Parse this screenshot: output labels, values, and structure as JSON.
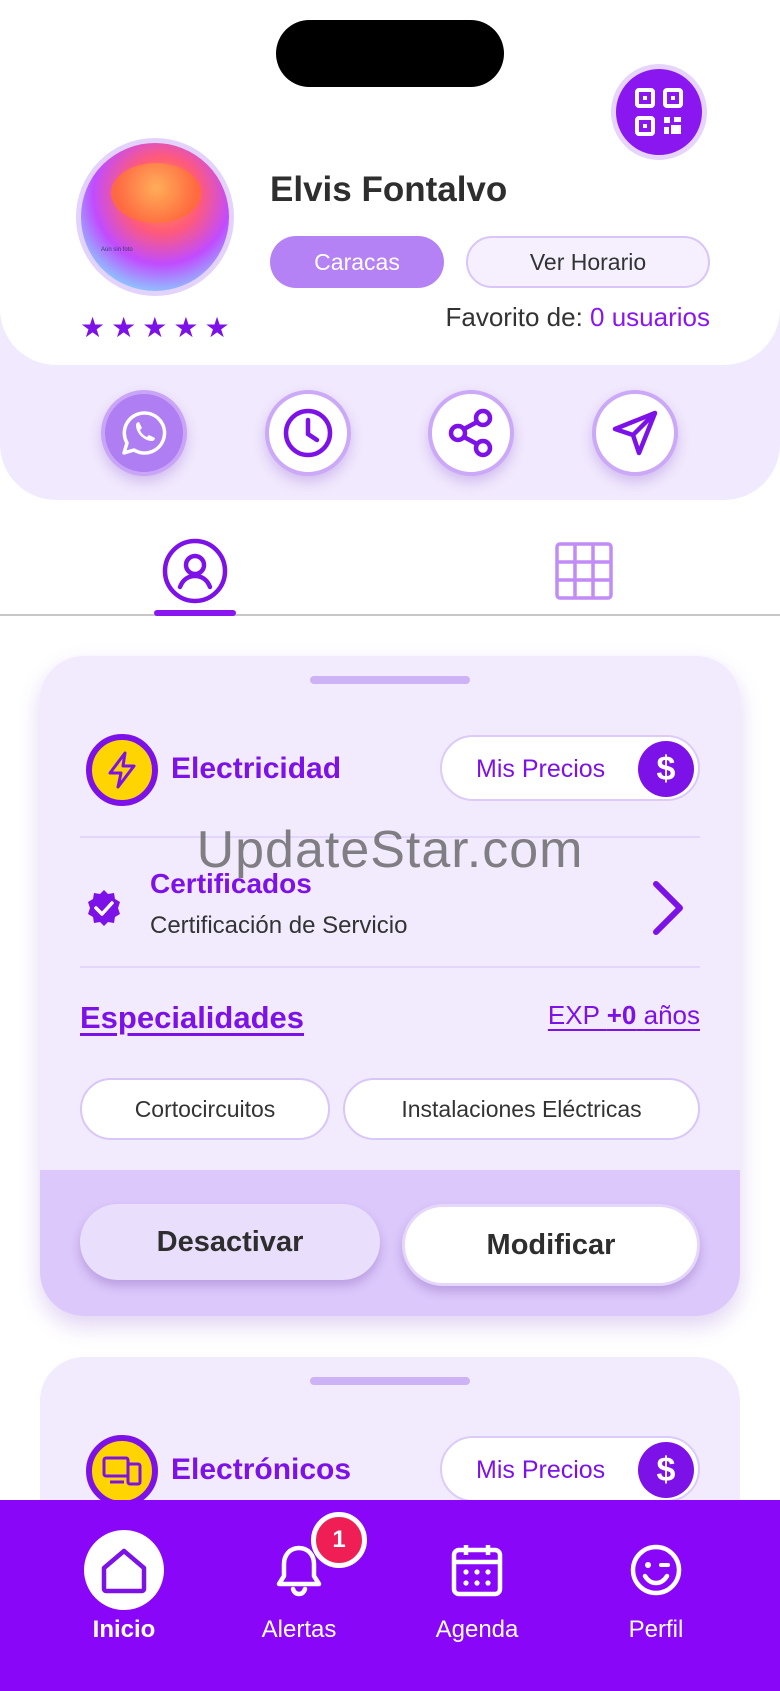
{
  "profile": {
    "name": "Elvis Fontalvo",
    "city": "Caracas",
    "schedule_label": "Ver Horario",
    "favorite_label": "Favorito de:",
    "favorite_count": "0 usuarios",
    "rating_stars": 5,
    "avatar_caption": "Aún sin foto"
  },
  "quick_actions": [
    {
      "icon": "whatsapp-icon"
    },
    {
      "icon": "clock-icon"
    },
    {
      "icon": "share-icon"
    },
    {
      "icon": "send-icon"
    }
  ],
  "tabs": [
    {
      "icon": "profile-icon",
      "active": true
    },
    {
      "icon": "grid-icon",
      "active": false
    }
  ],
  "services": [
    {
      "category": "Electricidad",
      "icon": "lightning-icon",
      "prices_label": "Mis Precios",
      "currency_symbol": "$",
      "cert_title": "Certificados",
      "cert_subtitle": "Certificación de Servicio",
      "specialties_title": "Especialidades",
      "exp_prefix": "EXP",
      "exp_value": "+0",
      "exp_suffix": "años",
      "specialties": [
        "Cortocircuitos",
        "Instalaciones Eléctricas"
      ],
      "deactivate_label": "Desactivar",
      "modify_label": "Modificar"
    },
    {
      "category": "Electrónicos",
      "icon": "devices-icon",
      "prices_label": "Mis Precios",
      "currency_symbol": "$"
    }
  ],
  "watermark": "UpdateStar.com",
  "bottom_nav": {
    "items": [
      {
        "label": "Inicio",
        "icon": "home-icon",
        "active": true
      },
      {
        "label": "Alertas",
        "icon": "bell-icon",
        "active": false
      },
      {
        "label": "Agenda",
        "icon": "calendar-icon",
        "active": false
      },
      {
        "label": "Perfil",
        "icon": "smiley-icon",
        "active": false
      }
    ],
    "alerts_badge": "1"
  },
  "colors": {
    "accent": "#8a17f0",
    "nav_bg": "#8a06f8",
    "card_bg": "#f2eafd",
    "badge": "#ef1f55",
    "category_icon_bg": "#ffd400"
  }
}
